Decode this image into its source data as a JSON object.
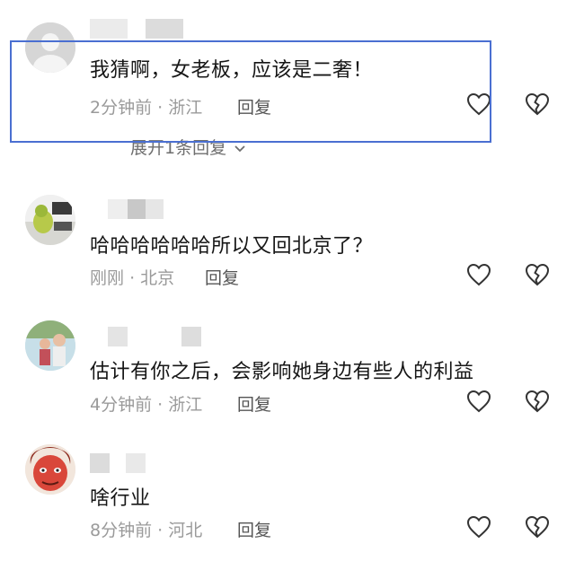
{
  "comments": [
    {
      "text": "我猜啊，女老板，应该是二奢！",
      "time": "2分钟前",
      "location": "浙江",
      "reply": "回复",
      "sep": "·",
      "expand": "展开1条回复",
      "expand_icon": "chevron-down-icon"
    },
    {
      "text": "哈哈哈哈哈哈所以又回北京了？",
      "time": "刚刚",
      "location": "北京",
      "reply": "回复",
      "sep": "·"
    },
    {
      "text": "估计有你之后，会影响她身边有些人的利益",
      "time": "4分钟前",
      "location": "浙江",
      "reply": "回复",
      "sep": "·"
    },
    {
      "text": "啥行业",
      "time": "8分钟前",
      "location": "河北",
      "reply": "回复",
      "sep": "·"
    }
  ],
  "icons": {
    "like": "heart-icon",
    "dislike": "broken-heart-icon"
  },
  "colors": {
    "highlight": "#4a6fd1",
    "meta": "#9a9a9a",
    "text": "#161616"
  }
}
